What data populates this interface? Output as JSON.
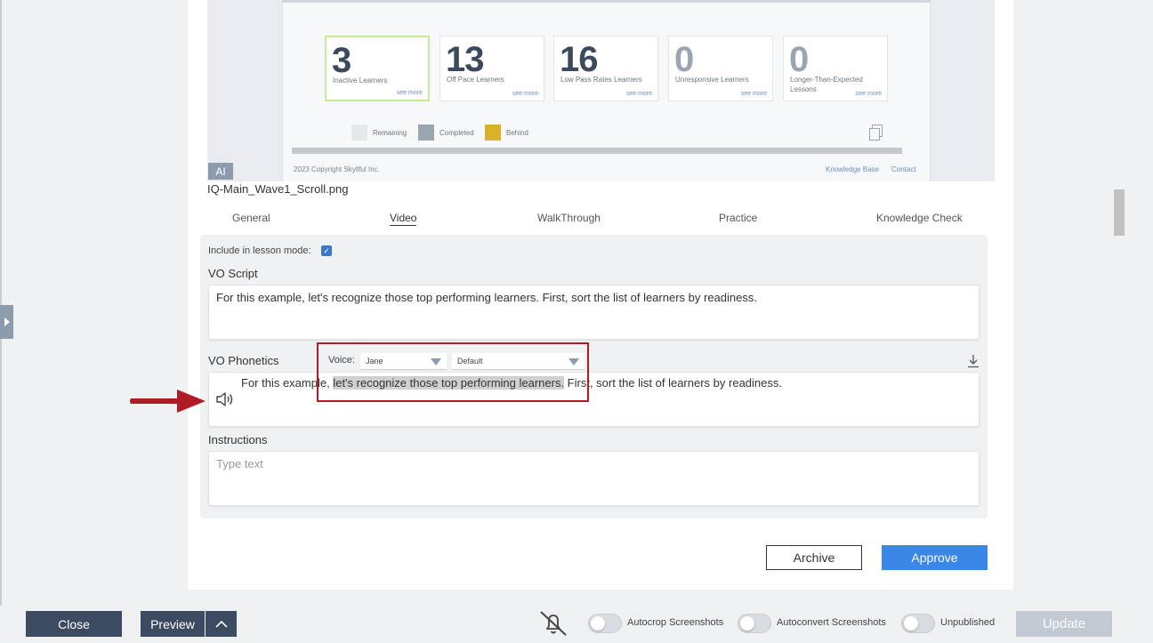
{
  "screenshot": {
    "cards": [
      {
        "number": "3",
        "label": "Inactive Learners",
        "more": "see more"
      },
      {
        "number": "13",
        "label": "Off Pace Learners",
        "more": "see more"
      },
      {
        "number": "16",
        "label": "Low Pass Rates Learners",
        "more": "see more"
      },
      {
        "number": "0",
        "label": "Unresponsive Learners",
        "more": "see more"
      },
      {
        "number": "0",
        "label": "Longer-Than-Expected Lessons",
        "more": "see more"
      }
    ],
    "legend": [
      {
        "label": "Remaining",
        "color": "#e6e8ea"
      },
      {
        "label": "Completed",
        "color": "#9aa5ad"
      },
      {
        "label": "Behind",
        "color": "#d9b227"
      }
    ],
    "copyright": "2023 Copyright Skyllful Inc.",
    "links": [
      "Knowledge Base",
      "Contact"
    ],
    "badge": "AI"
  },
  "filename": "IQ-Main_Wave1_Scroll.png",
  "tabs": [
    "General",
    "Video",
    "WalkThrough",
    "Practice",
    "Knowledge Check"
  ],
  "active_tab": "Video",
  "form": {
    "include_label": "Include in lesson mode:",
    "include_checked": true,
    "vo_script_label": "VO Script",
    "vo_script_text": "For this example, let's recognize those top performing learners. First, sort the list of learners by readiness.",
    "vo_phonetics_label": "VO Phonetics",
    "phonetics_before": "For this example, ",
    "phonetics_highlight": "let's recognize those top performing learners.",
    "phonetics_after": " First, sort the list of learners by readiness.",
    "voice_label": "Voice:",
    "voice_value": "Jane",
    "style_value": "Default",
    "instructions_label": "Instructions",
    "instructions_placeholder": "Type text"
  },
  "actions": {
    "archive": "Archive",
    "approve": "Approve"
  },
  "bottombar": {
    "close": "Close",
    "preview": "Preview",
    "toggles": [
      "Autocrop Screenshots",
      "Autoconvert Screenshots",
      "Unpublished"
    ],
    "update": "Update"
  },
  "colors": {
    "accent": "#3b87e8",
    "highlight_box": "#b01c25",
    "arrow": "#b01c25",
    "dark_button": "#3c4a62"
  }
}
